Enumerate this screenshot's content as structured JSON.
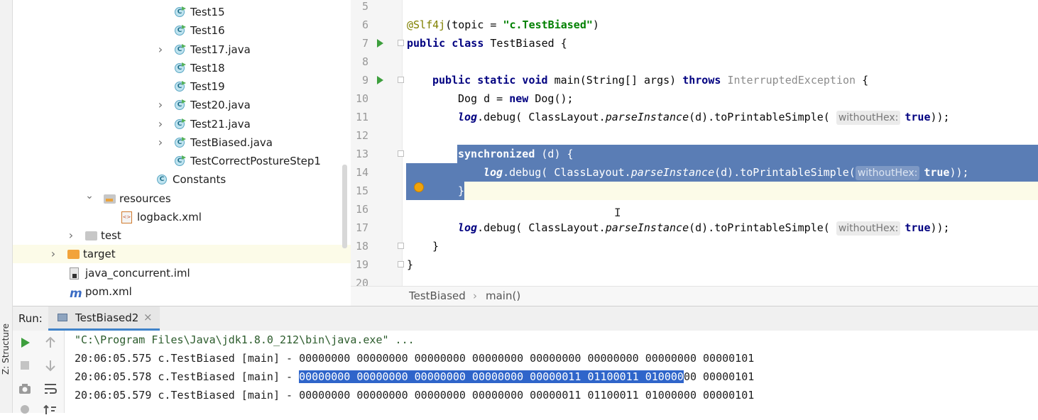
{
  "side_tabs": {
    "structure": "Z: Structure"
  },
  "project_tree": [
    {
      "label": "Test15",
      "icon": "java-class-icon",
      "arrow": false,
      "green": true
    },
    {
      "label": "Test16",
      "icon": "java-class-icon",
      "arrow": false,
      "green": true
    },
    {
      "label": "Test17.java",
      "icon": "java-class-icon",
      "arrow": true,
      "green": true
    },
    {
      "label": "Test18",
      "icon": "java-class-icon",
      "arrow": false,
      "green": true
    },
    {
      "label": "Test19",
      "icon": "java-class-icon",
      "arrow": false,
      "green": true
    },
    {
      "label": "Test20.java",
      "icon": "java-class-icon",
      "arrow": true,
      "green": true
    },
    {
      "label": "Test21.java",
      "icon": "java-class-icon",
      "arrow": true,
      "green": true
    },
    {
      "label": "TestBiased.java",
      "icon": "java-class-icon",
      "arrow": true,
      "green": true
    },
    {
      "label": "TestCorrectPostureStep1",
      "icon": "java-class-icon",
      "arrow": false,
      "green": true
    },
    {
      "label": "Constants",
      "icon": "java-class-icon",
      "arrow": false,
      "green": false
    },
    {
      "label": "resources",
      "icon": "resources-folder-icon",
      "arrow": true
    },
    {
      "label": "logback.xml",
      "icon": "xml-file-icon",
      "arrow": false
    },
    {
      "label": "test",
      "icon": "folder-icon",
      "arrow": true
    },
    {
      "label": "target",
      "icon": "folder-icon",
      "arrow": true
    },
    {
      "label": "java_concurrent.iml",
      "icon": "iml-file-icon",
      "arrow": false
    },
    {
      "label": "pom.xml",
      "icon": "maven-icon",
      "arrow": false
    }
  ],
  "editor": {
    "line_numbers": [
      "5",
      "6",
      "7",
      "8",
      "9",
      "10",
      "11",
      "12",
      "13",
      "14",
      "15",
      "16",
      "17",
      "18",
      "19",
      "20"
    ],
    "line6": {
      "annotation": "@Slf4j",
      "open": "(topic = ",
      "string": "\"c.TestBiased\"",
      "close": ")"
    },
    "line7": {
      "kw": "public class ",
      "name": "TestBiased",
      "rest": " {"
    },
    "line9": {
      "kw": "public static void ",
      "name": "main(String[] args) ",
      "throws": "throws ",
      "exception": "InterruptedException",
      "rest": " {"
    },
    "line10": {
      "pre": "Dog d = ",
      "kw": "new ",
      "rest": "Dog();"
    },
    "line11": {
      "log": "log",
      "mid": ".debug( ClassLayout.",
      "parse": "parseInstance",
      "end": "(d).toPrintableSimple( ",
      "hint": "withoutHex:",
      "val": "true",
      "close": "));"
    },
    "line13": {
      "kw": "synchronized",
      "rest": " (d) {"
    },
    "line14": {
      "log": "log",
      "mid": ".debug( ClassLayout.",
      "parse": "parseInstance",
      "end": "(d).toPrintableSimple(",
      "hint": "withoutHex:",
      "val": "true",
      "close": "));"
    },
    "line15": {
      "text": "}"
    },
    "line17": {
      "log": "log",
      "mid": ".debug( ClassLayout.",
      "parse": "parseInstance",
      "end": "(d).toPrintableSimple( ",
      "hint": "withoutHex:",
      "val": "true",
      "close": "));"
    },
    "line18": {
      "text": "}"
    },
    "line19": {
      "text": "}"
    }
  },
  "breadcrumb": {
    "class": "TestBiased",
    "separator": "›",
    "method": "main()"
  },
  "run": {
    "label": "Run:",
    "tab": "TestBiased2",
    "close": "×",
    "console": {
      "cmd": "\"C:\\Program Files\\Java\\jdk1.8.0_212\\bin\\java.exe\" ...",
      "line1": "20:06:05.575 c.TestBiased [main] - 00000000 00000000 00000000 00000000 00000000 00000000 00000000 00000101",
      "line2_prefix": "20:06:05.578 c.TestBiased [main] - ",
      "line2_sel": "00000000 00000000 00000000 00000000 00000011 01100011 010000",
      "line2_rest": "00 00000101",
      "line3": "20:06:05.579 c.TestBiased [main] - 00000000 00000000 00000000 00000000 00000011 01100011 01000000 00000101"
    }
  }
}
